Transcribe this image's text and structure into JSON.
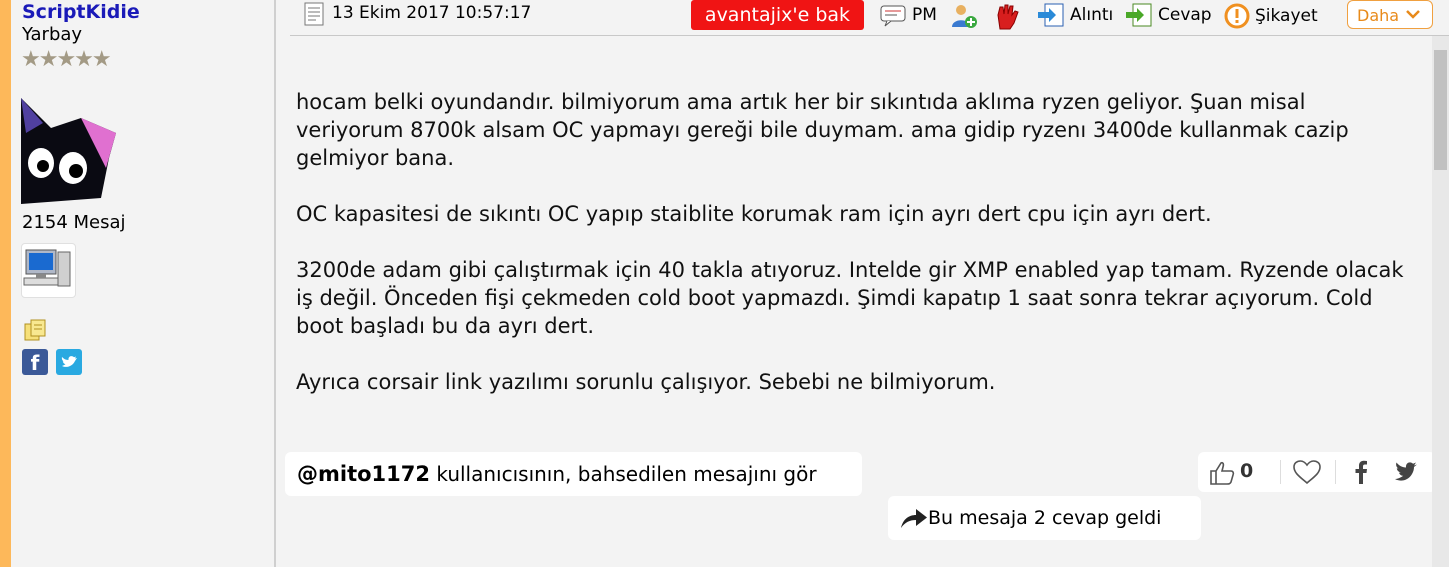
{
  "sidebar": {
    "username": "ScriptKidie",
    "rank": "Yarbay",
    "stars": "★★★★★",
    "message_count": "2154 Mesaj"
  },
  "toolbar": {
    "date": "13 Ekim 2017 10:57:17",
    "advantage_label": "avantajix'e bak",
    "pm_label": "PM",
    "quote_label": "Alıntı",
    "reply_label": "Cevap",
    "report_label": "Şikayet",
    "more_label": "Daha"
  },
  "post": {
    "text": "hocam belki oyundandır. bilmiyorum ama artık her bir sıkıntıda aklıma ryzen geliyor. Şuan misal veriyorum 8700k alsam OC yapmayı gereği bile duymam. ama gidip ryzenı 3400de kullanmak cazip gelmiyor bana.\n\nOC kapasitesi de sıkıntı OC yapıp staiblite korumak ram için ayrı dert cpu için ayrı dert.\n\n3200de adam gibi çalıştırmak için 40 takla atıyoruz. Intelde gir XMP enabled yap tamam. Ryzende olacak iş değil. Önceden fişi çekmeden cold boot yapmazdı. Şimdi kapatıp 1 saat sonra tekrar açıyorum. Cold boot başladı bu da ayrı dert.\n\nAyrıca corsair link yazılımı sorunlu çalışıyor. Sebebi ne bilmiyorum."
  },
  "mention": {
    "user": "@mito1172",
    "text": " kullanıcısının, bahsedilen mesajını gör"
  },
  "reactions": {
    "like_count": "0"
  },
  "replies": {
    "label": "Bu mesaja 2 cevap geldi"
  },
  "colors": {
    "accent": "#fdb85a",
    "username": "#1a1ab8",
    "advantage_bg": "#f01414",
    "more_border": "#f0a040"
  },
  "icons": [
    "calendar-icon",
    "pm-icon",
    "add-friend-icon",
    "block-hand-icon",
    "quote-icon",
    "reply-icon",
    "report-icon",
    "chevron-down-icon",
    "computer-icon",
    "copy-icon",
    "facebook-icon",
    "twitter-icon",
    "like-icon",
    "heart-icon",
    "share-arrow-icon"
  ]
}
